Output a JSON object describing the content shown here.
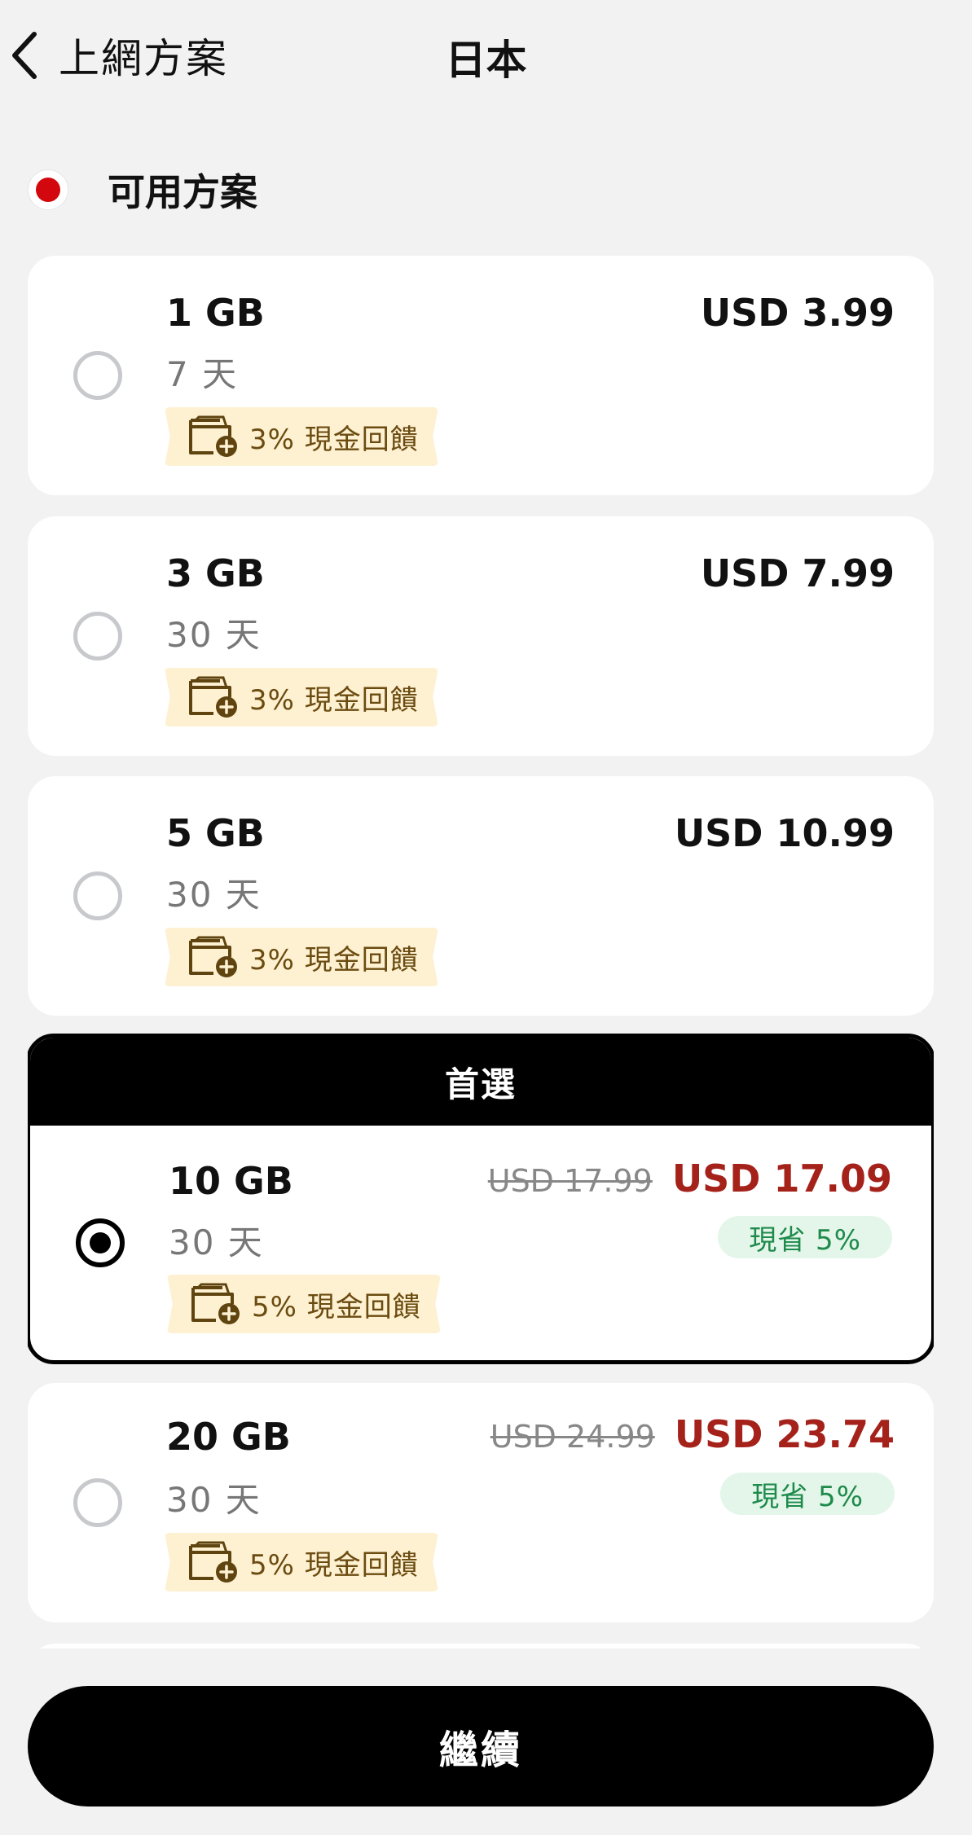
{
  "header": {
    "back_label": "上網方案",
    "title": "日本"
  },
  "section": {
    "title": "可用方案"
  },
  "plans": [
    {
      "data": "1 GB",
      "days": "7 天",
      "price": "USD 3.99",
      "cashback": "3% 現金回饋"
    },
    {
      "data": "3 GB",
      "days": "30 天",
      "price": "USD 7.99",
      "cashback": "3% 現金回饋"
    },
    {
      "data": "5 GB",
      "days": "30 天",
      "price": "USD 10.99",
      "cashback": "3% 現金回饋"
    },
    {
      "badge": "首選",
      "data": "10 GB",
      "days": "30 天",
      "old_price": "USD 17.99",
      "price": "USD 17.09",
      "save": "現省 5%",
      "cashback": "5% 現金回饋",
      "selected": true
    },
    {
      "data": "20 GB",
      "days": "30 天",
      "old_price": "USD 24.99",
      "price": "USD 23.74",
      "save": "現省 5%",
      "cashback": "5% 現金回饋"
    }
  ],
  "footer": {
    "continue_label": "繼續"
  },
  "colors": {
    "accent_red": "#d3070e",
    "sale_price": "#a5221b",
    "save_green": "#1e8a4b",
    "cashback_bg": "#fdf1d2"
  }
}
